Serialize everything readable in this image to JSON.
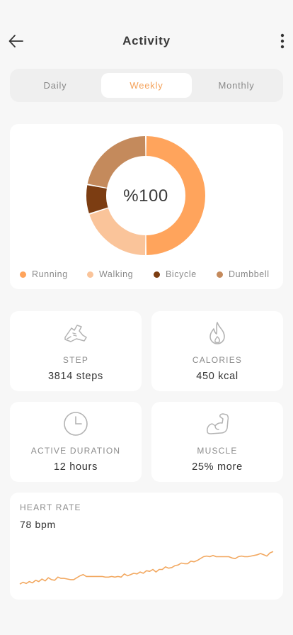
{
  "header": {
    "title": "Activity",
    "back_icon": "arrow-left-icon",
    "more_icon": "more-vertical-icon"
  },
  "tabs": [
    {
      "label": "Daily",
      "active": false
    },
    {
      "label": "Weekly",
      "active": true
    },
    {
      "label": "Monthly",
      "active": false
    }
  ],
  "summary": {
    "center_text": "%100"
  },
  "chart_data": {
    "type": "pie",
    "title": "",
    "center_label": "%100",
    "categories": [
      "Running",
      "Walking",
      "Bicycle",
      "Dumbbell"
    ],
    "values": [
      50,
      20,
      8,
      22
    ],
    "colors": [
      "#ffa45c",
      "#fac49a",
      "#7c3d12",
      "#c48a5c"
    ],
    "legend_position": "bottom",
    "heart_rate": {
      "type": "line",
      "title": "HEART RATE",
      "current": "78 bpm",
      "grid": false,
      "color": "#f2a860",
      "values": [
        12,
        15,
        13,
        16,
        14,
        18,
        16,
        20,
        17,
        22,
        19,
        18,
        23,
        21,
        21,
        20,
        19,
        19,
        22,
        25,
        27,
        24,
        24,
        24,
        24,
        24,
        24,
        23,
        23,
        24,
        23,
        24,
        23,
        28,
        25,
        27,
        29,
        28,
        31,
        29,
        33,
        32,
        35,
        31,
        35,
        35,
        39,
        37,
        38,
        41,
        42,
        45,
        44,
        44,
        48,
        47,
        49,
        52,
        55,
        56,
        55,
        57,
        55,
        55,
        55,
        55,
        55,
        53,
        52,
        55,
        56,
        55,
        55,
        56,
        57,
        58,
        60,
        58,
        56,
        61,
        63
      ]
    }
  },
  "stats": [
    {
      "label": "STEP",
      "value": "3814 steps",
      "icon": "sneaker-icon"
    },
    {
      "label": "CALORIES",
      "value": "450 kcal",
      "icon": "flame-icon"
    },
    {
      "label": "ACTIVE DURATION",
      "value": "12 hours",
      "icon": "clock-icon"
    },
    {
      "label": "MUSCLE",
      "value": "25% more",
      "icon": "bicep-icon"
    }
  ],
  "colors": {
    "accent": "#f4a25a",
    "background": "#f7f7f7",
    "card": "#ffffff",
    "icon_stroke": "#b3b3b3"
  }
}
